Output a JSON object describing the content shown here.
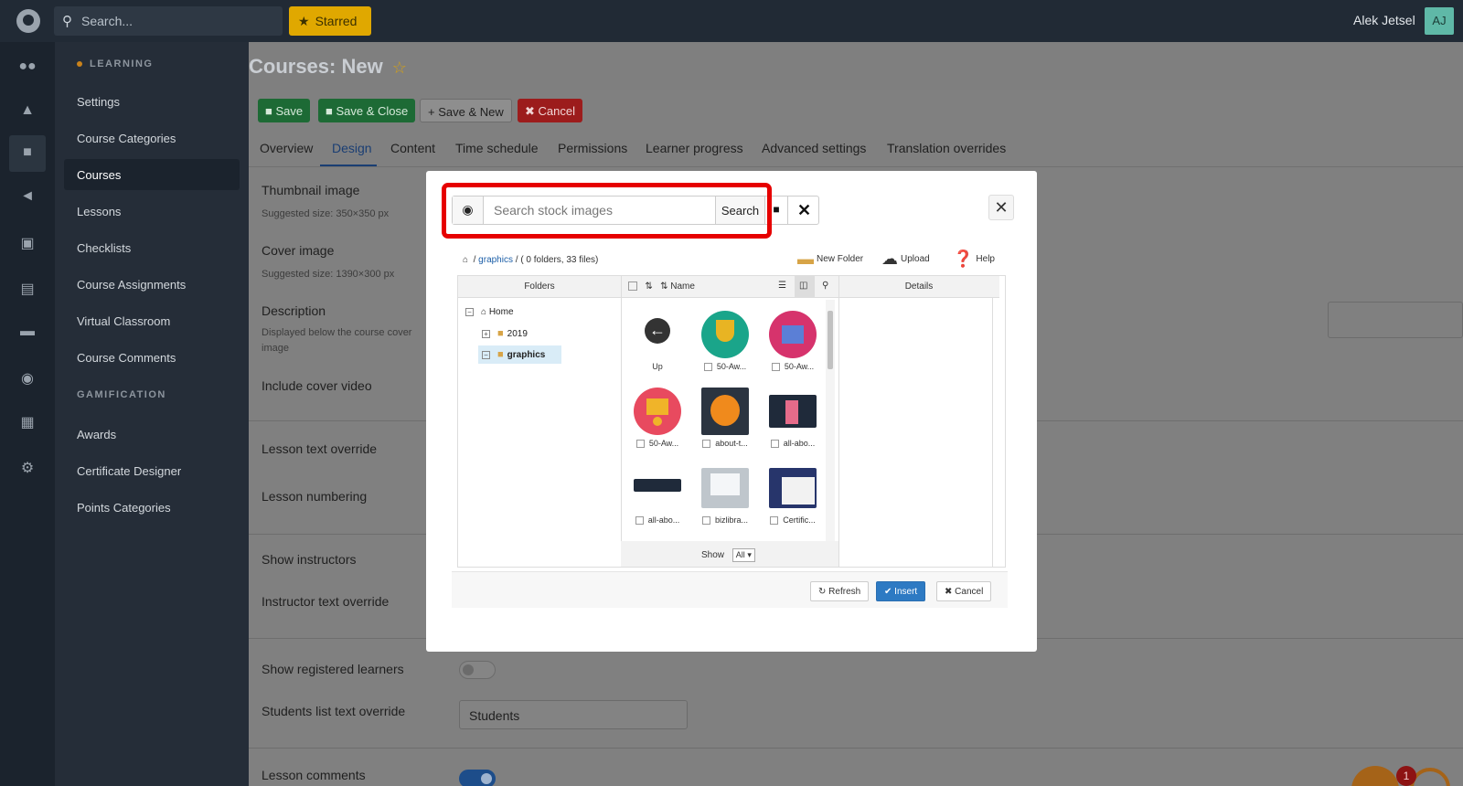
{
  "topbar": {
    "search_placeholder": "Search...",
    "starred_label": "Starred",
    "user_name": "Alek Jetsel",
    "user_initials": "AJ"
  },
  "rail": {
    "icons": [
      "users-icon",
      "shapes-icon",
      "graduation-cap-icon",
      "megaphone-icon",
      "ticket-icon",
      "chart-icon",
      "chat-icon",
      "palette-icon",
      "calendar-icon",
      "gear-icon"
    ]
  },
  "sidenav": {
    "learning_heading": "LEARNING",
    "learning_items": [
      "Settings",
      "Course Categories",
      "Courses",
      "Lessons",
      "Checklists",
      "Course Assignments",
      "Virtual Classroom",
      "Course Comments"
    ],
    "gamification_heading": "GAMIFICATION",
    "gamification_items": [
      "Awards",
      "Certificate Designer",
      "Points Categories"
    ],
    "active_item": "Courses"
  },
  "page": {
    "title": "Courses: New",
    "toolbar": {
      "save": "Save",
      "save_close": "Save & Close",
      "save_new": "Save & New",
      "cancel": "Cancel"
    },
    "tabs": [
      "Overview",
      "Design",
      "Content",
      "Time schedule",
      "Permissions",
      "Learner progress",
      "Advanced settings",
      "Translation overrides"
    ],
    "active_tab": "Design",
    "fields": {
      "thumbnail_label": "Thumbnail image",
      "thumbnail_help": "Suggested size: 350×350 px",
      "cover_label": "Cover image",
      "cover_help": "Suggested size: 1390×300 px",
      "description_label": "Description",
      "description_help": "Displayed below the course cover image",
      "cover_video_label": "Include cover video",
      "lesson_text_label": "Lesson text override",
      "lesson_numbering_label": "Lesson numbering",
      "show_instructors_label": "Show instructors",
      "instructor_text_label": "Instructor text override",
      "show_registered_label": "Show registered learners",
      "show_registered_on": false,
      "students_list_label": "Students list text override",
      "students_list_value": "Students",
      "lesson_comments_label": "Lesson comments",
      "lesson_comments_on": true
    }
  },
  "chat": {
    "badge_count": "1"
  },
  "modal": {
    "search_placeholder": "Search stock images",
    "search_button": "Search",
    "breadcrumb_folder": "graphics",
    "breadcrumb_info": "( 0 folders, 33 files)",
    "actions": {
      "new_folder": "New Folder",
      "upload": "Upload",
      "help": "Help"
    },
    "columns": {
      "folders": "Folders",
      "name": "Name",
      "details": "Details"
    },
    "tree": {
      "home": "Home",
      "folder_2019": "2019",
      "folder_graphics": "graphics"
    },
    "files": [
      {
        "caption": "Up",
        "kind": "up"
      },
      {
        "caption": "50-Aw...",
        "kind": "trophy"
      },
      {
        "caption": "50-Aw...",
        "kind": "gift"
      },
      {
        "caption": "50-Aw...",
        "kind": "crown"
      },
      {
        "caption": "about-t...",
        "kind": "elephant"
      },
      {
        "caption": "all-abo...",
        "kind": "people"
      },
      {
        "caption": "all-abo...",
        "kind": "banner"
      },
      {
        "caption": "bizlibra...",
        "kind": "laptop"
      },
      {
        "caption": "Certific...",
        "kind": "certificate"
      }
    ],
    "show_label": "Show",
    "show_value": "All",
    "footer": {
      "refresh": "Refresh",
      "insert": "Insert",
      "cancel": "Cancel"
    }
  }
}
